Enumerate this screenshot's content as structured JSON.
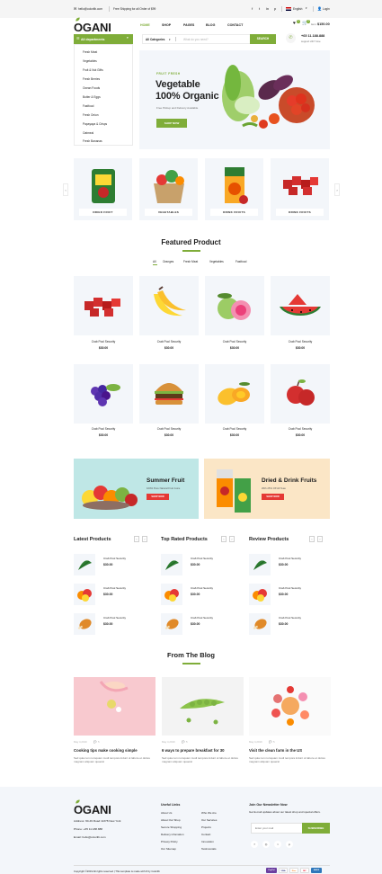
{
  "topbar": {
    "email": "hello@colorlib.com",
    "shipping": "Free Shipping for all Order of $99",
    "language": "English",
    "login": "Login"
  },
  "brand": {
    "name": "GANI",
    "first_letter": "O",
    "accent": "#7fad39"
  },
  "nav": {
    "home": "HOME",
    "shop": "SHOP",
    "pages": "PAGES",
    "blog": "BLOG",
    "contact": "CONTACT"
  },
  "cart": {
    "wish_count": "1",
    "cart_count": "3",
    "item_label": "item:",
    "total": "$150.00"
  },
  "departments": {
    "button": "All departments",
    "items": [
      "Fresh Meat",
      "Vegetables",
      "Fruit & Nut Gifts",
      "Fresh Berries",
      "Ocean Foods",
      "Butter & Eggs",
      "Fastfood",
      "Fresh Onion",
      "Papayaya & Crisps",
      "Oatmeal",
      "Fresh Bananas"
    ]
  },
  "search": {
    "category": "All Categories",
    "placeholder": "What do you need?",
    "button": "SEARCH"
  },
  "phone": {
    "number": "+65 11.188.888",
    "support": "support 24/7 time"
  },
  "hero": {
    "subtitle": "FRUIT FRESH",
    "title1": "Vegetable",
    "title2": "100% Organic",
    "text": "Free Pickup and Delivery Available",
    "button": "SHOP NOW"
  },
  "categories": [
    "DRIED FRUIT",
    "VEGETABLES",
    "DRINK FRUITS",
    "DRINK FRUITS"
  ],
  "featured": {
    "title": "Featured Product",
    "filters": [
      "All",
      "Oranges",
      "Fresh Meat",
      "Vegetables",
      "Fastfood"
    ],
    "product_name": "Crab Pool Security",
    "product_price": "$30.00"
  },
  "banners": {
    "b1_title": "Summer Fruit",
    "b1_text": "100% Pure Natural Fruit Juice",
    "b1_button": "SHOP NOW",
    "b2_title": "Dried & Drink Fruits",
    "b2_text": "With 25% Off All Teas",
    "b2_button": "SHOP NOW"
  },
  "lists": {
    "latest": "Latest Products",
    "top": "Top Rated Products",
    "review": "Review Products",
    "item_name": "Crab Pool Security",
    "item_price": "$30.00"
  },
  "blog": {
    "title": "From The Blog",
    "date": "May 4,2019",
    "comments": "5",
    "posts": [
      {
        "title": "Cooking tips make cooking simple",
        "text": "Sed quia non numquam modi tempora indunt ut labore et dolore magnam aliquam quaerat"
      },
      {
        "title": "6 ways to prepare breakfast for 30",
        "text": "Sed quia non numquam modi tempora indunt ut labore et dolore magnam aliquam quaerat"
      },
      {
        "title": "Visit the clean farm in the US",
        "text": "Sed quia non numquam modi tempora indunt ut labore et dolore magnam aliquam quaerat"
      }
    ]
  },
  "footer": {
    "address": "Address: 60-49 Road 11378 New York",
    "phone": "Phone: +65 11.188.888",
    "email": "Email: hello@colorlib.com",
    "useful_title": "Useful Links",
    "col1": [
      "About Us",
      "About Our Shop",
      "Secure Shopping",
      "Delivery infomation",
      "Privacy Policy",
      "Our Sitemap"
    ],
    "col2": [
      "Who We Are",
      "Our Services",
      "Projects",
      "Contact",
      "Innovation",
      "Testimonials"
    ],
    "newsletter_title": "Join Our Newsletter Now",
    "newsletter_text": "Get E-mail updates about our latest shop and special offers.",
    "placeholder": "Enter your mail",
    "subscribe": "SUBSCRIBE",
    "copyright": "Copyright ©2019 All rights reserved | This template is made with ♥ by Colorlib",
    "payments": [
      "PayPal",
      "VISA",
      "Disc",
      "MC",
      "AMEX"
    ]
  }
}
